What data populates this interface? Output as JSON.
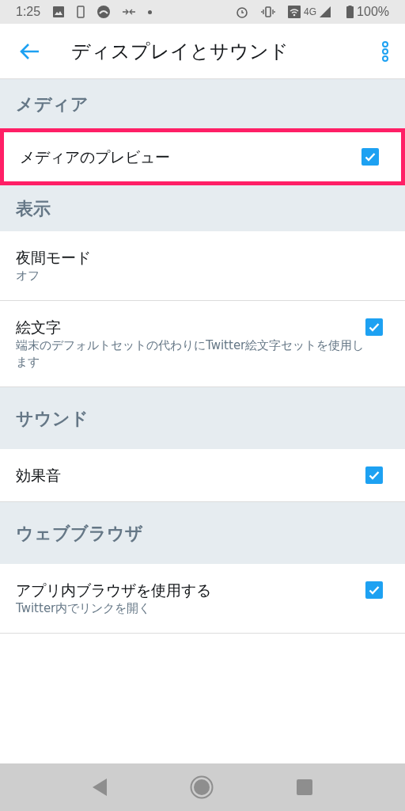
{
  "status_bar": {
    "time": "1:25",
    "network": "4G",
    "battery": "100%"
  },
  "app_bar": {
    "title": "ディスプレイとサウンド"
  },
  "sections": [
    {
      "title": "メディア",
      "items": [
        {
          "kind": "checkbox",
          "label": "メディアのプレビュー",
          "checked": true,
          "highlighted": true
        }
      ]
    },
    {
      "title": "表示",
      "items": [
        {
          "kind": "value",
          "label": "夜間モード",
          "subtitle": "オフ",
          "highlighted": false
        },
        {
          "kind": "checkbox",
          "label": "絵文字",
          "subtitle": "端末のデフォルトセットの代わりにTwitter絵文字セットを使用します",
          "checked": true,
          "highlighted": false
        }
      ]
    },
    {
      "title": "サウンド",
      "items": [
        {
          "kind": "checkbox",
          "label": "効果音",
          "checked": true,
          "highlighted": false
        }
      ]
    },
    {
      "title": "ウェブブラウザ",
      "items": [
        {
          "kind": "checkbox",
          "label": "アプリ内ブラウザを使用する",
          "subtitle": "Twitter内でリンクを開く",
          "checked": true,
          "highlighted": false
        }
      ]
    }
  ]
}
